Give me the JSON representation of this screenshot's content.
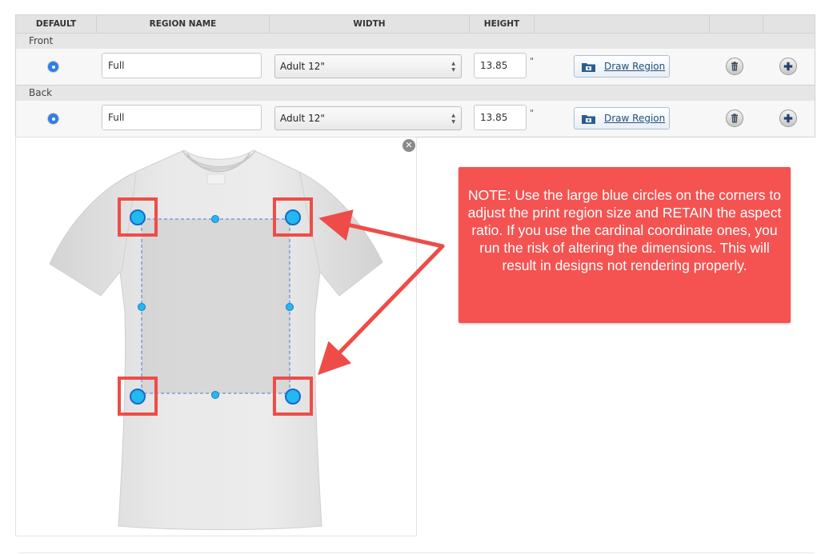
{
  "table": {
    "headers": {
      "default": "DEFAULT",
      "region_name": "REGION NAME",
      "width": "WIDTH",
      "height": "HEIGHT"
    },
    "groups": [
      {
        "label": "Front",
        "region_name": "Full",
        "width": "Adult 12\"",
        "height": "13.85",
        "unit": "\"",
        "draw_button": "Draw Region",
        "default_selected": true
      },
      {
        "label": "Back",
        "region_name": "Full",
        "width": "Adult 12\"",
        "height": "13.85",
        "unit": "\"",
        "draw_button": "Draw Region",
        "default_selected": true
      }
    ]
  },
  "preview": {
    "close_icon": "close-icon",
    "shirt_tag": "GILDAN"
  },
  "note": {
    "text": "NOTE: Use the large blue circles on the corners to adjust the print region size and RETAIN the aspect ratio. If you use the cardinal coordinate ones, you run the risk of altering the dimensions. This will result in designs not rendering properly."
  },
  "colors": {
    "accent": "#2f7ee8",
    "note_bg": "#f45351",
    "handle": "#22b8f0",
    "highlight_box": "#ee4c48"
  }
}
